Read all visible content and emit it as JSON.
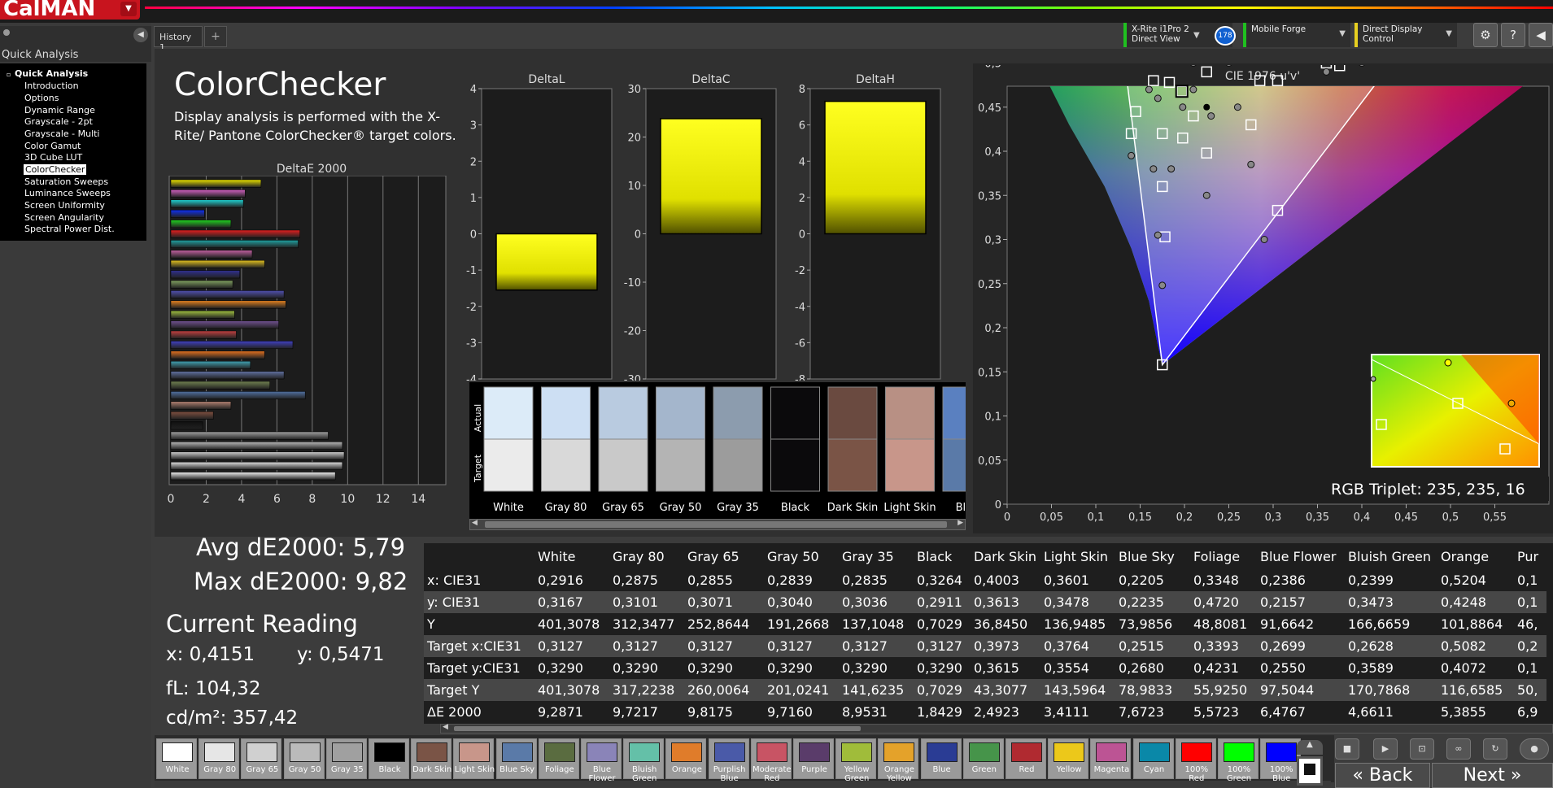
{
  "app": {
    "logo": "CalMAN",
    "history_tab": "History 1",
    "add_tab": "+"
  },
  "instruments": {
    "meter": "X-Rite i1Pro 2 Direct View",
    "meter_badge": "178",
    "source": "Mobile Forge",
    "display": "Direct Display Control",
    "settings_icon": "⚙",
    "help_icon": "?"
  },
  "sidebar": {
    "title": "Quick Analysis",
    "group": "Quick Analysis",
    "items": [
      "Introduction",
      "Options",
      "Dynamic Range",
      "Grayscale - 2pt",
      "Grayscale - Multi",
      "Color Gamut",
      "3D Cube LUT",
      "ColorChecker",
      "Saturation Sweeps",
      "Luminance Sweeps",
      "Screen Uniformity",
      "Screen Angularity",
      "Spectral Power Dist."
    ],
    "selected": "ColorChecker"
  },
  "page": {
    "title": "ColorChecker",
    "description": "Display analysis is performed with the X-Rite/ Pantone ColorChecker® target colors."
  },
  "stats": {
    "avg": "Avg dE2000: 5,79",
    "max": "Max dE2000: 9,82",
    "current_reading": "Current Reading",
    "x": "x: 0,4151",
    "y": "y: 0,5471",
    "fl": "fL: 104,32",
    "cdm2": "cd/m²: 357,42"
  },
  "deltae_chart": {
    "title": "DeltaE 2000",
    "ticks": [
      "0",
      "2",
      "4",
      "6",
      "8",
      "10",
      "12",
      "14"
    ],
    "xlim": [
      0,
      15
    ],
    "bars": [
      {
        "value": 5.1,
        "color": "#e8e000"
      },
      {
        "value": 4.2,
        "color": "#d060c0"
      },
      {
        "value": 4.1,
        "color": "#20d0d0"
      },
      {
        "value": 1.9,
        "color": "#1030f0"
      },
      {
        "value": 3.4,
        "color": "#20d020"
      },
      {
        "value": 7.3,
        "color": "#e02020"
      },
      {
        "value": 7.2,
        "color": "#20a0a0"
      },
      {
        "value": 4.6,
        "color": "#c060a0"
      },
      {
        "value": 5.3,
        "color": "#e0c020"
      },
      {
        "value": 3.9,
        "color": "#303090"
      },
      {
        "value": 3.5,
        "color": "#80a060"
      },
      {
        "value": 6.4,
        "color": "#5050b0"
      },
      {
        "value": 6.5,
        "color": "#e08020"
      },
      {
        "value": 3.6,
        "color": "#a0c040"
      },
      {
        "value": 6.1,
        "color": "#705090"
      },
      {
        "value": 3.7,
        "color": "#c04040"
      },
      {
        "value": 6.9,
        "color": "#4040c0"
      },
      {
        "value": 5.3,
        "color": "#e07020"
      },
      {
        "value": 4.5,
        "color": "#40a0b0"
      },
      {
        "value": 6.4,
        "color": "#6070a0"
      },
      {
        "value": 5.6,
        "color": "#708050"
      },
      {
        "value": 7.6,
        "color": "#5070a0"
      },
      {
        "value": 3.4,
        "color": "#b08070"
      },
      {
        "value": 2.4,
        "color": "#805040"
      },
      {
        "value": 1.8,
        "color": "#101010"
      },
      {
        "value": 8.9,
        "color": "#a0a0a0"
      },
      {
        "value": 9.7,
        "color": "#b8b8b8"
      },
      {
        "value": 9.8,
        "color": "#cccccc"
      },
      {
        "value": 9.7,
        "color": "#dddddd"
      },
      {
        "value": 9.3,
        "color": "#eeeeee"
      }
    ]
  },
  "delta_charts": [
    {
      "title": "DeltaL",
      "ticks": [
        "4",
        "3",
        "2",
        "1",
        "0",
        "-1",
        "-2",
        "-3",
        "-4"
      ],
      "ylim": [
        -4,
        4
      ],
      "value": -1.55
    },
    {
      "title": "DeltaC",
      "ticks": [
        "30",
        "20",
        "10",
        "0",
        "-10",
        "-20",
        "-30"
      ],
      "ylim": [
        -30,
        30
      ],
      "value": 23.8
    },
    {
      "title": "DeltaH",
      "ticks": [
        "8",
        "6",
        "4",
        "2",
        "0",
        "-2",
        "-4",
        "-6",
        "-8"
      ],
      "ylim": [
        -8,
        8
      ],
      "value": 7.3
    }
  ],
  "patch_strip": {
    "actual_label": "Actual",
    "target_label": "Target",
    "patches": [
      {
        "name": "White",
        "actual": "#dcebf8",
        "target": "#ebebeb"
      },
      {
        "name": "Gray 80",
        "actual": "#cddff3",
        "target": "#d9d9d9"
      },
      {
        "name": "Gray 65",
        "actual": "#b9cbe0",
        "target": "#c9c9c9"
      },
      {
        "name": "Gray 50",
        "actual": "#a4b6cc",
        "target": "#b4b4b4"
      },
      {
        "name": "Gray 35",
        "actual": "#8c9cae",
        "target": "#9c9c9c"
      },
      {
        "name": "Black",
        "actual": "#0b0a0c",
        "target": "#0b0a0c"
      },
      {
        "name": "Dark Skin",
        "actual": "#6a4a40",
        "target": "#7a5446"
      },
      {
        "name": "Light Skin",
        "actual": "#b89084",
        "target": "#c8968a"
      },
      {
        "name": "Blue",
        "actual": "#5a80c0",
        "target": "#5a7aa8"
      }
    ]
  },
  "cie": {
    "title": "CIE 1976 u'v'",
    "xticks": [
      "0",
      "0,05",
      "0,1",
      "0,15",
      "0,2",
      "0,25",
      "0,3",
      "0,35",
      "0,4",
      "0,45",
      "0,5",
      "0,55"
    ],
    "yticks": [
      "0,55",
      "0,5",
      "0,45",
      "0,4",
      "0,35",
      "0,3",
      "0,25",
      "0,2",
      "0,15",
      "0,1",
      "0,05",
      "0"
    ],
    "rgb_triplet": "RGB Triplet: 235, 235, 16",
    "gamut_corners": {
      "red": [
        0.451,
        0.523
      ],
      "green": [
        0.125,
        0.562
      ],
      "blue": [
        0.175,
        0.158
      ]
    },
    "measured": [
      [
        0.21,
        0.47
      ],
      [
        0.198,
        0.45
      ],
      [
        0.23,
        0.44
      ],
      [
        0.225,
        0.35
      ],
      [
        0.25,
        0.5
      ],
      [
        0.33,
        0.51
      ],
      [
        0.36,
        0.49
      ],
      [
        0.4,
        0.5
      ],
      [
        0.26,
        0.45
      ],
      [
        0.29,
        0.54
      ],
      [
        0.17,
        0.52
      ],
      [
        0.17,
        0.46
      ],
      [
        0.195,
        0.535
      ],
      [
        0.185,
        0.56
      ],
      [
        0.235,
        0.545
      ],
      [
        0.13,
        0.54
      ],
      [
        0.16,
        0.54
      ],
      [
        0.21,
        0.5
      ],
      [
        0.26,
        0.55
      ],
      [
        0.16,
        0.47
      ],
      [
        0.14,
        0.395
      ],
      [
        0.165,
        0.38
      ],
      [
        0.185,
        0.38
      ],
      [
        0.17,
        0.305
      ],
      [
        0.175,
        0.248
      ],
      [
        0.275,
        0.385
      ],
      [
        0.29,
        0.3
      ],
      [
        0.125,
        0.575
      ],
      [
        0.445,
        0.53
      ],
      [
        0.195,
        0.57
      ]
    ],
    "targets": [
      [
        0.197,
        0.468
      ],
      [
        0.21,
        0.44
      ],
      [
        0.183,
        0.478
      ],
      [
        0.15,
        0.53
      ],
      [
        0.171,
        0.52
      ],
      [
        0.225,
        0.49
      ],
      [
        0.22,
        0.545
      ],
      [
        0.245,
        0.543
      ],
      [
        0.29,
        0.538
      ],
      [
        0.36,
        0.5
      ],
      [
        0.375,
        0.497
      ],
      [
        0.165,
        0.48
      ],
      [
        0.145,
        0.445
      ],
      [
        0.14,
        0.42
      ],
      [
        0.175,
        0.42
      ],
      [
        0.198,
        0.415
      ],
      [
        0.225,
        0.398
      ],
      [
        0.275,
        0.43
      ],
      [
        0.175,
        0.36
      ],
      [
        0.178,
        0.303
      ],
      [
        0.305,
        0.333
      ],
      [
        0.451,
        0.523
      ],
      [
        0.175,
        0.158
      ],
      [
        0.128,
        0.563
      ],
      [
        0.185,
        0.545
      ],
      [
        0.205,
        0.555
      ],
      [
        0.285,
        0.48
      ],
      [
        0.305,
        0.48
      ]
    ],
    "selected": [
      0.197,
      0.468
    ]
  },
  "table": {
    "columns": [
      "",
      "White",
      "Gray 80",
      "Gray 65",
      "Gray 50",
      "Gray 35",
      "Black",
      "Dark Skin",
      "Light Skin",
      "Blue Sky",
      "Foliage",
      "Blue Flower",
      "Bluish Green",
      "Orange",
      "Pur"
    ],
    "rows": [
      [
        "x: CIE31",
        "0,2916",
        "0,2875",
        "0,2855",
        "0,2839",
        "0,2835",
        "0,3264",
        "0,4003",
        "0,3601",
        "0,2205",
        "0,3348",
        "0,2386",
        "0,2399",
        "0,5204",
        "0,1"
      ],
      [
        "y: CIE31",
        "0,3167",
        "0,3101",
        "0,3071",
        "0,3040",
        "0,3036",
        "0,2911",
        "0,3613",
        "0,3478",
        "0,2235",
        "0,4720",
        "0,2157",
        "0,3473",
        "0,4248",
        "0,1"
      ],
      [
        "Y",
        "401,3078",
        "312,3477",
        "252,8644",
        "191,2668",
        "137,1048",
        "0,7029",
        "36,8450",
        "136,9485",
        "73,9856",
        "48,8081",
        "91,6642",
        "166,6659",
        "101,8864",
        "46,"
      ],
      [
        "Target x:CIE31",
        "0,3127",
        "0,3127",
        "0,3127",
        "0,3127",
        "0,3127",
        "0,3127",
        "0,3973",
        "0,3764",
        "0,2515",
        "0,3393",
        "0,2699",
        "0,2628",
        "0,5082",
        "0,2"
      ],
      [
        "Target y:CIE31",
        "0,3290",
        "0,3290",
        "0,3290",
        "0,3290",
        "0,3290",
        "0,3290",
        "0,3615",
        "0,3554",
        "0,2680",
        "0,4231",
        "0,2550",
        "0,3589",
        "0,4072",
        "0,1"
      ],
      [
        "Target Y",
        "401,3078",
        "317,2238",
        "260,0064",
        "201,0241",
        "141,6235",
        "0,7029",
        "43,3077",
        "143,5964",
        "78,9833",
        "55,9250",
        "97,5044",
        "170,7868",
        "116,6585",
        "50,"
      ],
      [
        "ΔE 2000",
        "9,2871",
        "9,7217",
        "9,8175",
        "9,7160",
        "8,9531",
        "1,8429",
        "2,4923",
        "3,4111",
        "7,6723",
        "5,5723",
        "6,4767",
        "4,6611",
        "5,3855",
        "6,9"
      ]
    ]
  },
  "swatches": [
    {
      "label": "White",
      "color": "#ffffff"
    },
    {
      "label": "Gray 80",
      "color": "#e6e6e6"
    },
    {
      "label": "Gray 65",
      "color": "#d0d0d0"
    },
    {
      "label": "Gray 50",
      "color": "#bababa"
    },
    {
      "label": "Gray 35",
      "color": "#a0a0a0"
    },
    {
      "label": "Black",
      "color": "#000000"
    },
    {
      "label": "Dark Skin",
      "color": "#7a5446"
    },
    {
      "label": "Light Skin",
      "color": "#c8968a"
    },
    {
      "label": "Blue Sky",
      "color": "#5a7aa8"
    },
    {
      "label": "Foliage",
      "color": "#5a6c40"
    },
    {
      "label": "Blue Flower",
      "color": "#8a84b8"
    },
    {
      "label": "Bluish Green",
      "color": "#64c0a8"
    },
    {
      "label": "Orange",
      "color": "#e07c2a"
    },
    {
      "label": "Purplish Blue",
      "color": "#4a5aa8"
    },
    {
      "label": "Moderate Red",
      "color": "#c85464"
    },
    {
      "label": "Purple",
      "color": "#5a3c6a"
    },
    {
      "label": "Yellow Green",
      "color": "#a0bc3a"
    },
    {
      "label": "Orange Yellow",
      "color": "#e4a22a"
    },
    {
      "label": "Blue",
      "color": "#2a3c94"
    },
    {
      "label": "Green",
      "color": "#46944a"
    },
    {
      "label": "Red",
      "color": "#b02a30"
    },
    {
      "label": "Yellow",
      "color": "#ecc81a"
    },
    {
      "label": "Magenta",
      "color": "#bc5494"
    },
    {
      "label": "Cyan",
      "color": "#0a88a8"
    },
    {
      "label": "100% Red",
      "color": "#ff0000"
    },
    {
      "label": "100% Green",
      "color": "#00ff00"
    },
    {
      "label": "100% Blue",
      "color": "#0000ff"
    }
  ],
  "nav": {
    "back": "Back",
    "next": "Next"
  }
}
